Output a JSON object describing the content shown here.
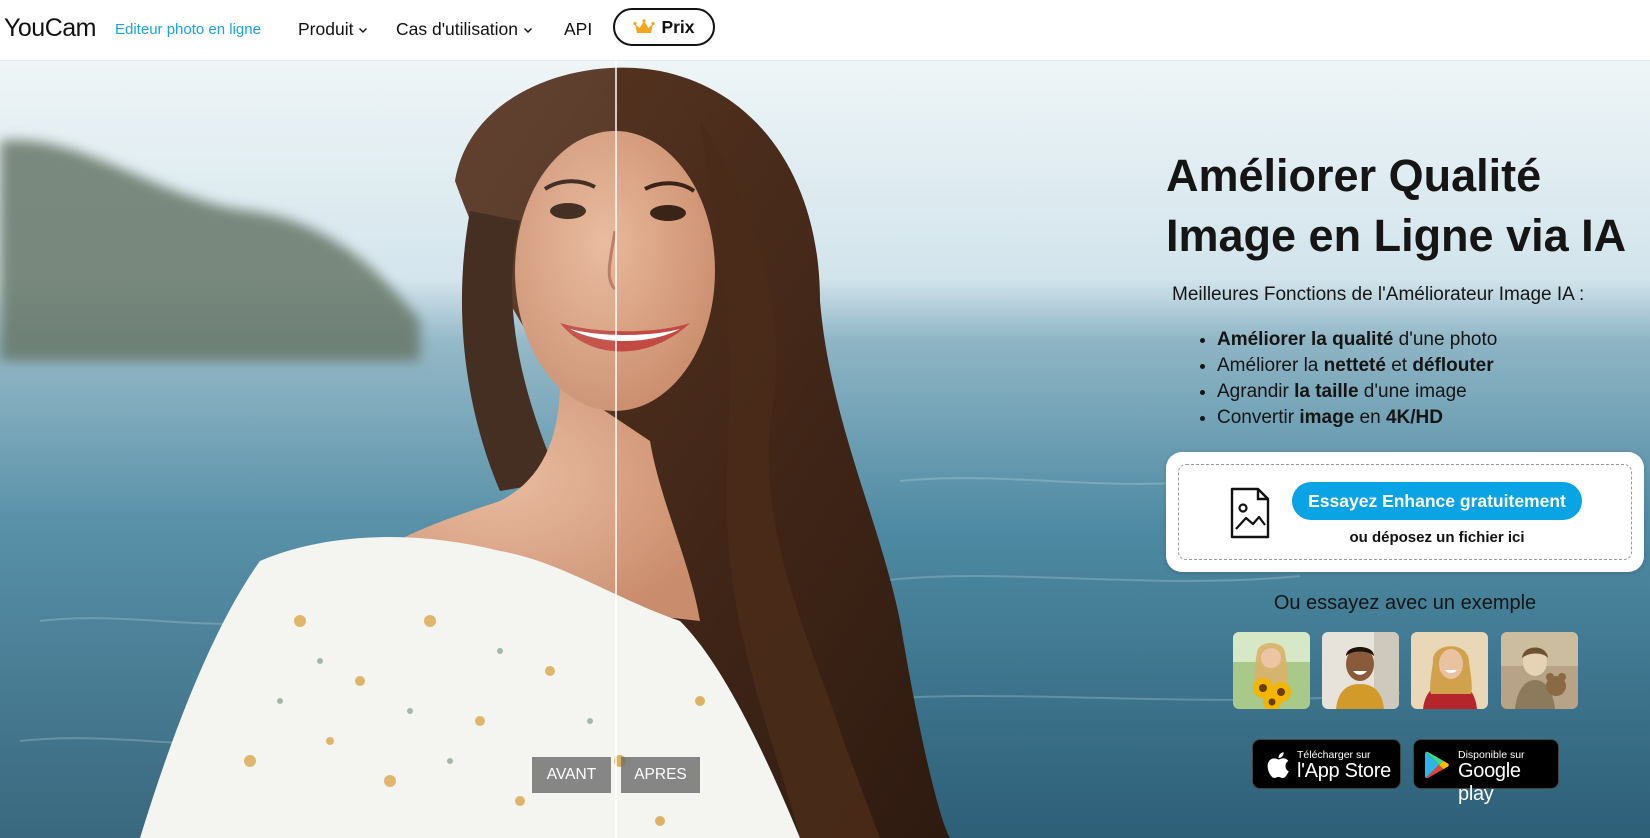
{
  "header": {
    "logo": "YouCam",
    "tagline": "Editeur photo en ligne",
    "nav": [
      {
        "label": "Produit",
        "has_dropdown": true
      },
      {
        "label": "Cas d'utilisation",
        "has_dropdown": true
      },
      {
        "label": "API",
        "has_dropdown": false
      }
    ],
    "price_button": {
      "label": "Prix",
      "icon": "crown-icon",
      "icon_color": "#f5a623"
    }
  },
  "hero": {
    "compare": {
      "before_label": "AVANT",
      "after_label": "APRES"
    },
    "headline_line1": "Améliorer Qualité",
    "headline_line2": "Image en Ligne via IA",
    "subheading": "Meilleures Fonctions de l'Améliorateur Image IA :",
    "features": [
      {
        "bold1": "Améliorer la qualité",
        "text1": " d'une photo",
        "bold2": "",
        "text2": "",
        "bold3": "",
        "text3": ""
      },
      {
        "bold1": "",
        "text1": "Améliorer la ",
        "bold2": "netteté",
        "text2": " et ",
        "bold3": "déflouter",
        "text3": ""
      },
      {
        "bold1": "",
        "text1": "Agrandir ",
        "bold2": "la taille",
        "text2": " d'une image",
        "bold3": "",
        "text3": ""
      },
      {
        "bold1": "",
        "text1": "Convertir ",
        "bold2": "image",
        "text2": " en ",
        "bold3": "4K/HD",
        "text3": ""
      }
    ],
    "upload": {
      "button_label": "Essayez Enhance gratuitement",
      "drop_text": "ou déposez un fichier ici",
      "icon": "image-file-icon"
    },
    "examples": {
      "title": "Ou essayez avec un exemple",
      "items": [
        "example-sunflowers",
        "example-man-smiling",
        "example-woman-red",
        "example-vintage-child"
      ]
    },
    "stores": {
      "app_store": {
        "small": "Télécharger sur",
        "big": "l'App Store"
      },
      "google_play": {
        "small": "Disponible sur",
        "big": "Google play"
      }
    }
  },
  "colors": {
    "accent": "#0aa3e3",
    "tagline": "#1aa3e0",
    "sea": "#4f8aa3",
    "sky": "#dfeef4",
    "hair": "#4a2c1c"
  }
}
